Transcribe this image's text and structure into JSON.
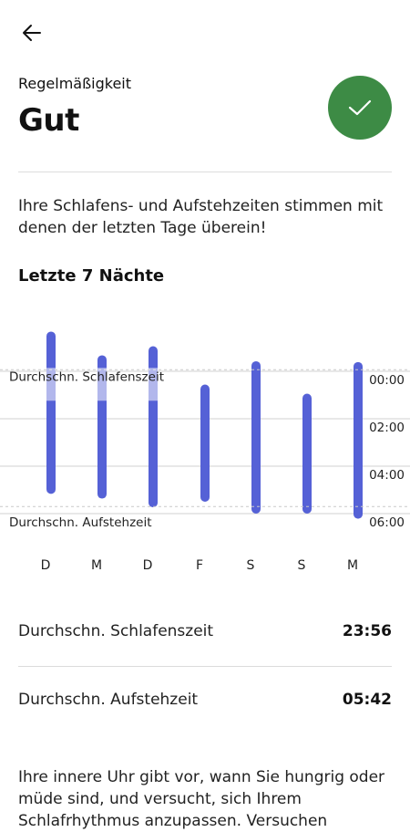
{
  "header": {
    "back_icon": "arrow-left-icon",
    "eyebrow": "Regelmäßigkeit",
    "status": "Gut",
    "status_icon": "checkmark-icon",
    "status_color": "#3d8b45"
  },
  "description": "Ihre Schlafens- und Aufstehzeiten stimmen mit denen der letzten Tage überein!",
  "section_title": "Letzte 7 Nächte",
  "chart_data": {
    "type": "range-bar",
    "categories": [
      "D",
      "M",
      "D",
      "F",
      "S",
      "S",
      "M"
    ],
    "bar_color": "#5561d6",
    "y_ticks": [
      "00:00",
      "02:00",
      "04:00",
      "06:00"
    ],
    "ylim": [
      "22:30",
      "06:40"
    ],
    "ranges": [
      {
        "start": "22:38",
        "end": "05:10"
      },
      {
        "start": "23:38",
        "end": "05:22"
      },
      {
        "start": "23:15",
        "end": "05:44"
      },
      {
        "start": "00:52",
        "end": "05:30"
      },
      {
        "start": "23:53",
        "end": "06:00"
      },
      {
        "start": "01:15",
        "end": "06:00"
      },
      {
        "start": "23:55",
        "end": "06:13"
      }
    ],
    "avg_sleep_label": "Durchschn. Schlafenszeit",
    "avg_wake_label": "Durchschn. Aufstehzeit",
    "avg_sleep": "23:56",
    "avg_wake": "05:42"
  },
  "stats": {
    "sleep_label": "Durchschn. Schlafenszeit",
    "sleep_value": "23:56",
    "wake_label": "Durchschn. Aufstehzeit",
    "wake_value": "05:42"
  },
  "info_text": "Ihre innere Uhr gibt vor, wann Sie hungrig oder müde sind, und versucht, sich Ihrem Schlafrhythmus anzupassen. Versuchen"
}
